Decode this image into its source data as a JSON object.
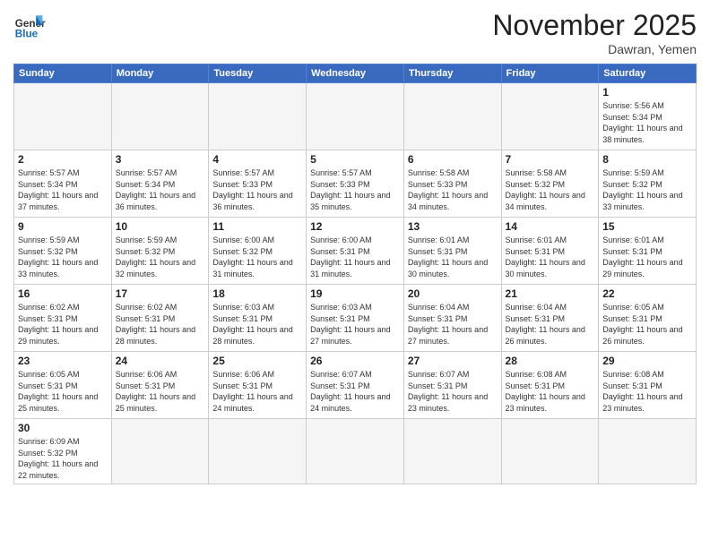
{
  "logo": {
    "text_general": "General",
    "text_blue": "Blue"
  },
  "header": {
    "month": "November 2025",
    "location": "Dawran, Yemen"
  },
  "weekdays": [
    "Sunday",
    "Monday",
    "Tuesday",
    "Wednesday",
    "Thursday",
    "Friday",
    "Saturday"
  ],
  "weeks": [
    [
      {
        "day": "",
        "info": ""
      },
      {
        "day": "",
        "info": ""
      },
      {
        "day": "",
        "info": ""
      },
      {
        "day": "",
        "info": ""
      },
      {
        "day": "",
        "info": ""
      },
      {
        "day": "",
        "info": ""
      },
      {
        "day": "1",
        "info": "Sunrise: 5:56 AM\nSunset: 5:34 PM\nDaylight: 11 hours and 38 minutes."
      }
    ],
    [
      {
        "day": "2",
        "info": "Sunrise: 5:57 AM\nSunset: 5:34 PM\nDaylight: 11 hours and 37 minutes."
      },
      {
        "day": "3",
        "info": "Sunrise: 5:57 AM\nSunset: 5:34 PM\nDaylight: 11 hours and 36 minutes."
      },
      {
        "day": "4",
        "info": "Sunrise: 5:57 AM\nSunset: 5:33 PM\nDaylight: 11 hours and 36 minutes."
      },
      {
        "day": "5",
        "info": "Sunrise: 5:57 AM\nSunset: 5:33 PM\nDaylight: 11 hours and 35 minutes."
      },
      {
        "day": "6",
        "info": "Sunrise: 5:58 AM\nSunset: 5:33 PM\nDaylight: 11 hours and 34 minutes."
      },
      {
        "day": "7",
        "info": "Sunrise: 5:58 AM\nSunset: 5:32 PM\nDaylight: 11 hours and 34 minutes."
      },
      {
        "day": "8",
        "info": "Sunrise: 5:59 AM\nSunset: 5:32 PM\nDaylight: 11 hours and 33 minutes."
      }
    ],
    [
      {
        "day": "9",
        "info": "Sunrise: 5:59 AM\nSunset: 5:32 PM\nDaylight: 11 hours and 33 minutes."
      },
      {
        "day": "10",
        "info": "Sunrise: 5:59 AM\nSunset: 5:32 PM\nDaylight: 11 hours and 32 minutes."
      },
      {
        "day": "11",
        "info": "Sunrise: 6:00 AM\nSunset: 5:32 PM\nDaylight: 11 hours and 31 minutes."
      },
      {
        "day": "12",
        "info": "Sunrise: 6:00 AM\nSunset: 5:31 PM\nDaylight: 11 hours and 31 minutes."
      },
      {
        "day": "13",
        "info": "Sunrise: 6:01 AM\nSunset: 5:31 PM\nDaylight: 11 hours and 30 minutes."
      },
      {
        "day": "14",
        "info": "Sunrise: 6:01 AM\nSunset: 5:31 PM\nDaylight: 11 hours and 30 minutes."
      },
      {
        "day": "15",
        "info": "Sunrise: 6:01 AM\nSunset: 5:31 PM\nDaylight: 11 hours and 29 minutes."
      }
    ],
    [
      {
        "day": "16",
        "info": "Sunrise: 6:02 AM\nSunset: 5:31 PM\nDaylight: 11 hours and 29 minutes."
      },
      {
        "day": "17",
        "info": "Sunrise: 6:02 AM\nSunset: 5:31 PM\nDaylight: 11 hours and 28 minutes."
      },
      {
        "day": "18",
        "info": "Sunrise: 6:03 AM\nSunset: 5:31 PM\nDaylight: 11 hours and 28 minutes."
      },
      {
        "day": "19",
        "info": "Sunrise: 6:03 AM\nSunset: 5:31 PM\nDaylight: 11 hours and 27 minutes."
      },
      {
        "day": "20",
        "info": "Sunrise: 6:04 AM\nSunset: 5:31 PM\nDaylight: 11 hours and 27 minutes."
      },
      {
        "day": "21",
        "info": "Sunrise: 6:04 AM\nSunset: 5:31 PM\nDaylight: 11 hours and 26 minutes."
      },
      {
        "day": "22",
        "info": "Sunrise: 6:05 AM\nSunset: 5:31 PM\nDaylight: 11 hours and 26 minutes."
      }
    ],
    [
      {
        "day": "23",
        "info": "Sunrise: 6:05 AM\nSunset: 5:31 PM\nDaylight: 11 hours and 25 minutes."
      },
      {
        "day": "24",
        "info": "Sunrise: 6:06 AM\nSunset: 5:31 PM\nDaylight: 11 hours and 25 minutes."
      },
      {
        "day": "25",
        "info": "Sunrise: 6:06 AM\nSunset: 5:31 PM\nDaylight: 11 hours and 24 minutes."
      },
      {
        "day": "26",
        "info": "Sunrise: 6:07 AM\nSunset: 5:31 PM\nDaylight: 11 hours and 24 minutes."
      },
      {
        "day": "27",
        "info": "Sunrise: 6:07 AM\nSunset: 5:31 PM\nDaylight: 11 hours and 23 minutes."
      },
      {
        "day": "28",
        "info": "Sunrise: 6:08 AM\nSunset: 5:31 PM\nDaylight: 11 hours and 23 minutes."
      },
      {
        "day": "29",
        "info": "Sunrise: 6:08 AM\nSunset: 5:31 PM\nDaylight: 11 hours and 23 minutes."
      }
    ],
    [
      {
        "day": "30",
        "info": "Sunrise: 6:09 AM\nSunset: 5:32 PM\nDaylight: 11 hours and 22 minutes."
      },
      {
        "day": "",
        "info": ""
      },
      {
        "day": "",
        "info": ""
      },
      {
        "day": "",
        "info": ""
      },
      {
        "day": "",
        "info": ""
      },
      {
        "day": "",
        "info": ""
      },
      {
        "day": "",
        "info": ""
      }
    ]
  ]
}
